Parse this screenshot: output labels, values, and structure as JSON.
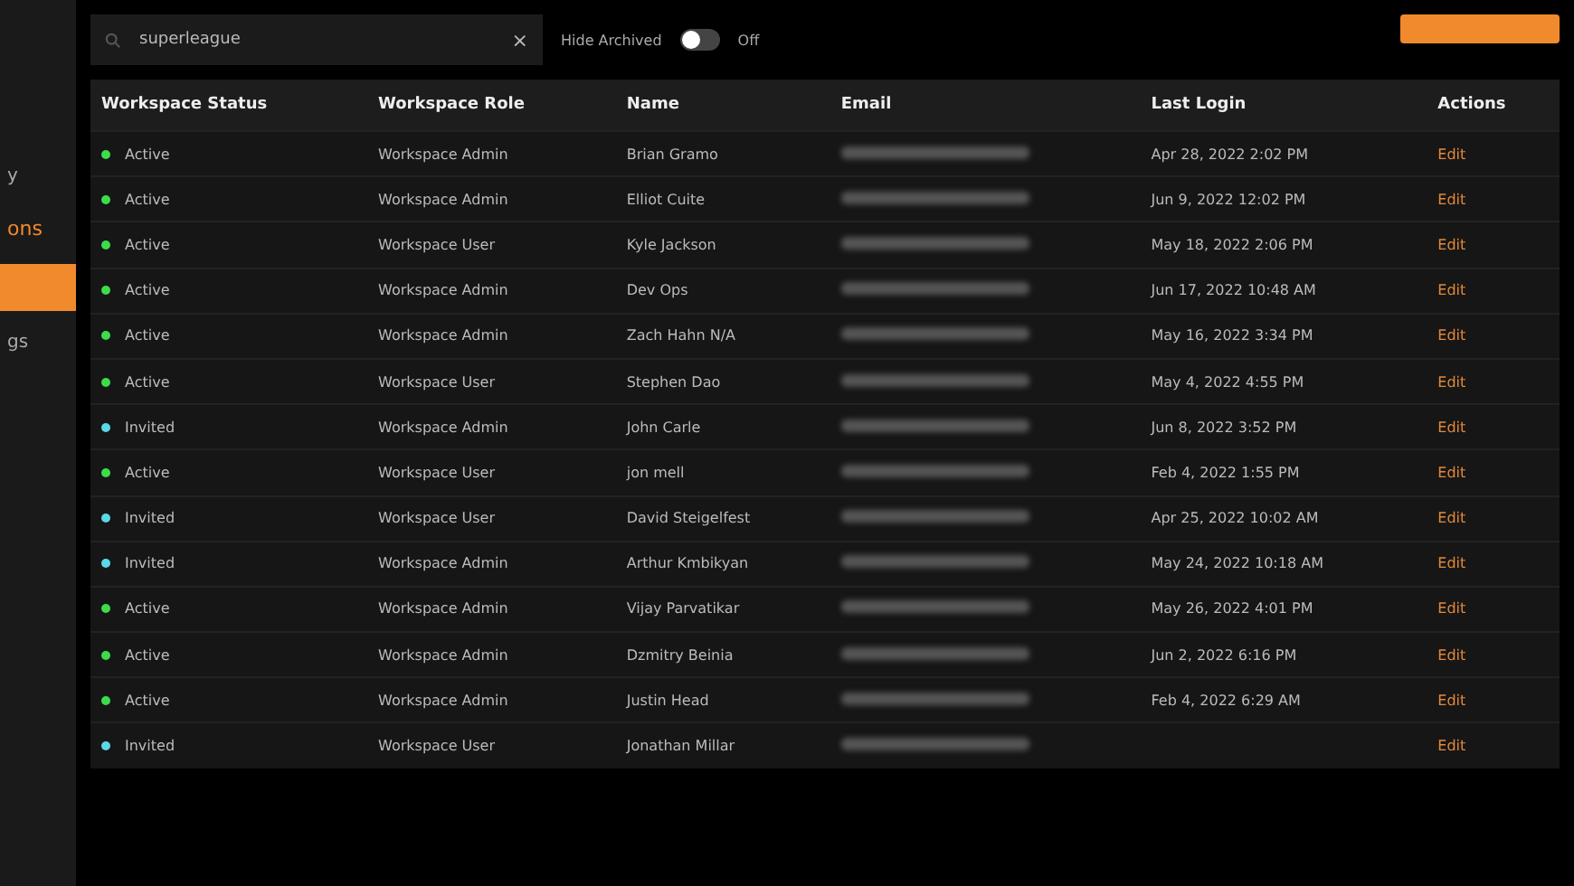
{
  "sidebar": {
    "items": [
      {
        "label": "y",
        "kind": "link",
        "selected": false
      },
      {
        "label": "ons",
        "kind": "section",
        "selected": false
      },
      {
        "kind": "link",
        "selected": true
      },
      {
        "label": "gs",
        "kind": "link",
        "selected": false
      }
    ]
  },
  "search": {
    "value": "superleague",
    "clear": "×"
  },
  "hide_archived": {
    "label": "Hide Archived",
    "on": false,
    "state_text": "Off"
  },
  "table": {
    "columns": [
      "Workspace Status",
      "Workspace Role",
      "Name",
      "Email",
      "Last Login",
      "Actions"
    ],
    "rows": [
      {
        "status": "Active",
        "role": "Workspace Admin",
        "name": "Brian Gramo",
        "last_login": "Apr 28, 2022 2:02 PM",
        "action": "Edit"
      },
      {
        "status": "Active",
        "role": "Workspace Admin",
        "name": "Elliot Cuite",
        "last_login": "Jun 9, 2022 12:02 PM",
        "action": "Edit"
      },
      {
        "status": "Active",
        "role": "Workspace User",
        "name": "Kyle Jackson",
        "last_login": "May 18, 2022 2:06 PM",
        "action": "Edit"
      },
      {
        "status": "Active",
        "role": "Workspace Admin",
        "name": "Dev Ops",
        "last_login": "Jun 17, 2022 10:48 AM",
        "action": "Edit"
      },
      {
        "status": "Active",
        "role": "Workspace Admin",
        "name": "Zach Hahn N/A",
        "last_login": "May 16, 2022 3:34 PM",
        "action": "Edit"
      },
      {
        "status": "Active",
        "role": "Workspace User",
        "name": "Stephen Dao",
        "last_login": "May 4, 2022 4:55 PM",
        "action": "Edit"
      },
      {
        "status": "Invited",
        "role": "Workspace Admin",
        "name": "John Carle",
        "last_login": "Jun 8, 2022 3:52 PM",
        "action": "Edit"
      },
      {
        "status": "Active",
        "role": "Workspace User",
        "name": "jon mell",
        "last_login": "Feb 4, 2022 1:55 PM",
        "action": "Edit"
      },
      {
        "status": "Invited",
        "role": "Workspace User",
        "name": "David Steigelfest",
        "last_login": "Apr 25, 2022 10:02 AM",
        "action": "Edit"
      },
      {
        "status": "Invited",
        "role": "Workspace Admin",
        "name": "Arthur Kmbikyan",
        "last_login": "May 24, 2022 10:18 AM",
        "action": "Edit"
      },
      {
        "status": "Active",
        "role": "Workspace Admin",
        "name": "Vijay Parvatikar",
        "last_login": "May 26, 2022 4:01 PM",
        "action": "Edit"
      },
      {
        "status": "Active",
        "role": "Workspace Admin",
        "name": "Dzmitry Beinia",
        "last_login": "Jun 2, 2022 6:16 PM",
        "action": "Edit"
      },
      {
        "status": "Active",
        "role": "Workspace Admin",
        "name": "Justin Head",
        "last_login": "Feb 4, 2022 6:29 AM",
        "action": "Edit"
      },
      {
        "status": "Invited",
        "role": "Workspace User",
        "name": "Jonathan Millar",
        "action": "Edit"
      }
    ]
  }
}
